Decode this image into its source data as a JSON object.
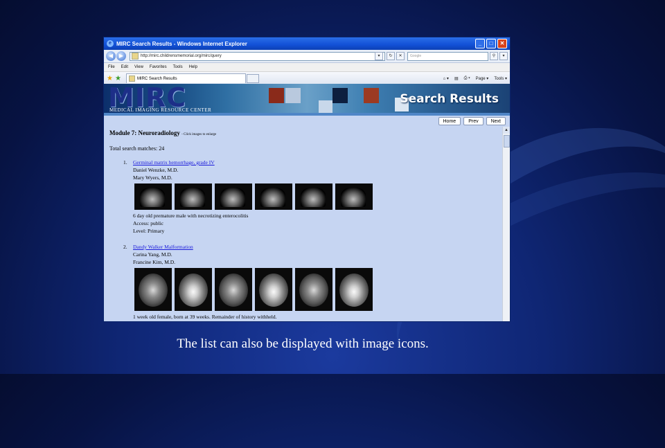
{
  "window": {
    "title": "MIRC Search Results - Windows Internet Explorer",
    "buttons": {
      "minimize": "_",
      "maximize": "□",
      "close": "✕"
    }
  },
  "address_bar": {
    "back": "◀",
    "forward": "▶",
    "url": "http://mirc.childrensmemorial.org/mirc/query",
    "search_placeholder": "Google"
  },
  "menu": [
    "File",
    "Edit",
    "View",
    "Favorites",
    "Tools",
    "Help"
  ],
  "favorites_bar": {
    "tab_label": "MIRC Search Results",
    "tools": [
      "Page ▾",
      "Tools ▾"
    ]
  },
  "banner": {
    "logo": "MIRC",
    "subtitle": "MEDICAL IMAGING RESOURCE CENTER",
    "heading": "Search Results"
  },
  "nav": {
    "home": "Home",
    "prev": "Prev",
    "next": "Next"
  },
  "page": {
    "module_title": "Module 7: Neuroradiology",
    "module_note": "- Click images to enlarge",
    "total_matches": "Total search matches: 24",
    "results": [
      {
        "num": "1.",
        "title": "Germinal matrix hemorrhage, grade IV",
        "authors": [
          "Daniel Wenzke, M.D.",
          "Mary Wyers, M.D."
        ],
        "description": "6 day old premature male with necrotizing enterocolitis",
        "access": "Access: public",
        "level": "Level: Primary"
      },
      {
        "num": "2.",
        "title": "Dandy Walker Malformation",
        "authors": [
          "Carina Yang, M.D.",
          "Francine Kim, M.D."
        ],
        "description": "1 week old female, born at 39 weeks. Remainder of history withheld."
      }
    ]
  },
  "caption": "The list can also be displayed with image icons."
}
